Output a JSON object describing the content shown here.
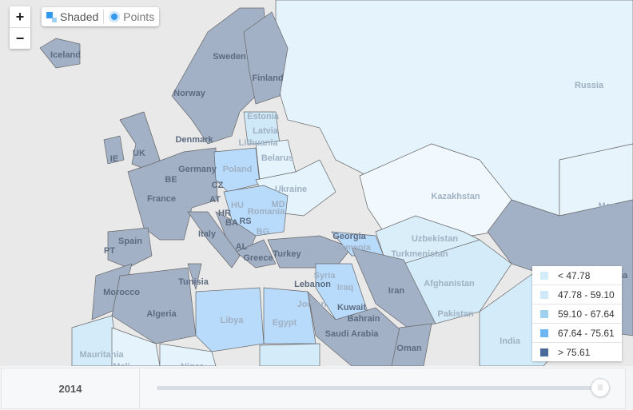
{
  "controls": {
    "zoom_in": "+",
    "zoom_out": "−",
    "shaded_label": "Shaded",
    "points_label": "Points",
    "shaded_icon": "shaded-squares-icon",
    "points_icon": "point-dot-icon"
  },
  "legend": {
    "items": [
      {
        "label": "< 47.78",
        "color": "#d4ecfa"
      },
      {
        "label": "47.78 - 59.10",
        "color": "#cfe9f8"
      },
      {
        "label": "59.10 - 67.64",
        "color": "#9fd0ee"
      },
      {
        "label": "67.64 - 75.61",
        "color": "#6cb6f3"
      },
      {
        "label": "> 75.61",
        "color": "#4a6c9b"
      }
    ]
  },
  "map": {
    "labels": [
      "Iceland",
      "Sweden",
      "Finland",
      "Norway",
      "Estonia",
      "Latvia",
      "Lithuania",
      "Denmark",
      "UK",
      "IE",
      "Germany",
      "Poland",
      "Belarus",
      "BE",
      "CZ",
      "France",
      "Ukraine",
      "AT",
      "HU",
      "Romania",
      "MD",
      "HR",
      "BA",
      "RS",
      "BG",
      "Italy",
      "Spain",
      "PT",
      "AL",
      "Greece",
      "Turkey",
      "Georgia",
      "Armenia",
      "Syria",
      "Lebanon",
      "Iraq",
      "Iran",
      "Jordan",
      "Kuwait",
      "Bahrain",
      "Saudi Arabia",
      "Oman",
      "Tunisia",
      "Morocco",
      "Algeria",
      "Libya",
      "Egypt",
      "Mauritania",
      "Mali",
      "Niger",
      "Russia",
      "Kazakhstan",
      "Mongol",
      "Uzbekistan",
      "Turkmenistan",
      "Afghanistan",
      "Pakistan",
      "India",
      "China"
    ]
  },
  "timeline": {
    "year": "2014",
    "position_percent": 100
  }
}
